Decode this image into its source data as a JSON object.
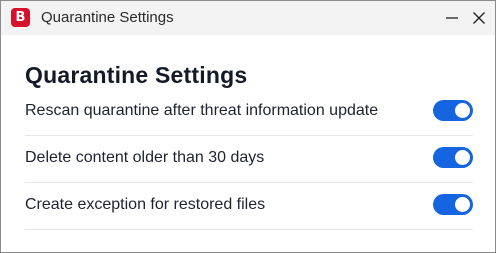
{
  "window": {
    "title": "Quarantine Settings",
    "logo_letter": "B",
    "brand_color": "#d7112a"
  },
  "page": {
    "heading": "Quarantine Settings"
  },
  "settings": [
    {
      "label": "Rescan quarantine after threat information update",
      "enabled": true
    },
    {
      "label": "Delete content older than 30 days",
      "enabled": true
    },
    {
      "label": "Create exception for restored files",
      "enabled": true
    }
  ],
  "colors": {
    "toggle_on": "#1565e0"
  }
}
